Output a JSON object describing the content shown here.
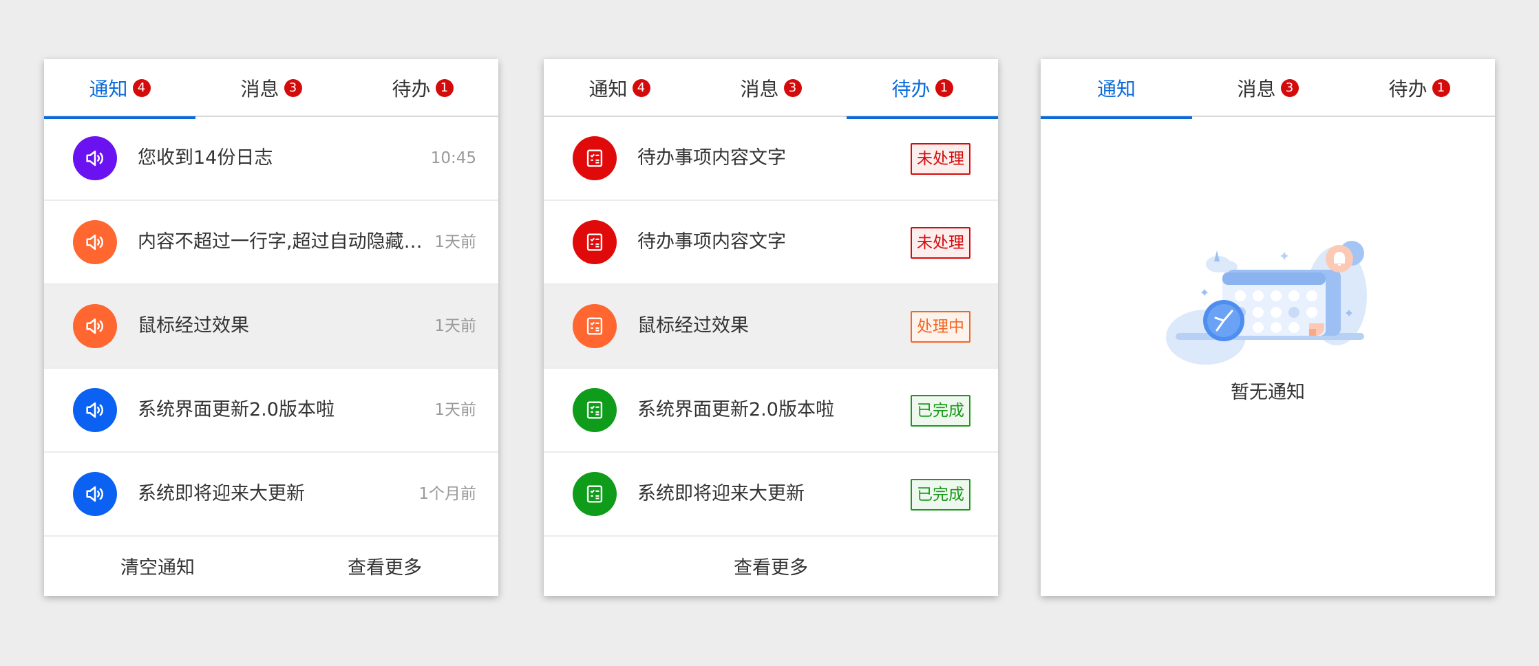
{
  "colors": {
    "accent": "#0b6bdb",
    "badge": "#d40b0b",
    "purple": "#6a12f0",
    "orange": "#ff6630",
    "blue": "#0b62f2",
    "red": "#e00a0a",
    "green": "#0f9c1a"
  },
  "panels": [
    {
      "tabs": [
        {
          "label": "通知",
          "badge": "4"
        },
        {
          "label": "消息",
          "badge": "3"
        },
        {
          "label": "待办",
          "badge": "1"
        }
      ],
      "items": [
        {
          "icon": "speaker-icon",
          "text": "您收到14份日志",
          "time": "10:45"
        },
        {
          "icon": "speaker-icon",
          "text": "内容不超过一行字,超过自动隐藏内容不超过一行字",
          "time": "1天前"
        },
        {
          "icon": "speaker-icon",
          "text": "鼠标经过效果",
          "time": "1天前"
        },
        {
          "icon": "speaker-icon",
          "text": "系统界面更新2.0版本啦",
          "time": "1天前"
        },
        {
          "icon": "speaker-icon",
          "text": "系统即将迎来大更新",
          "time": "1个月前"
        }
      ],
      "footer": [
        "清空通知",
        "查看更多"
      ]
    },
    {
      "tabs": [
        {
          "label": "通知",
          "badge": "4"
        },
        {
          "label": "消息",
          "badge": "3"
        },
        {
          "label": "待办",
          "badge": "1"
        }
      ],
      "items": [
        {
          "icon": "checklist-icon",
          "text": "待办事项内容文字",
          "status": "未处理"
        },
        {
          "icon": "checklist-icon",
          "text": "待办事项内容文字",
          "status": "未处理"
        },
        {
          "icon": "checklist-icon",
          "text": "鼠标经过效果",
          "status": "处理中"
        },
        {
          "icon": "checklist-icon",
          "text": "系统界面更新2.0版本啦",
          "status": "已完成"
        },
        {
          "icon": "checklist-icon",
          "text": "系统即将迎来大更新",
          "status": "已完成"
        }
      ],
      "footer": [
        "查看更多"
      ]
    },
    {
      "tabs": [
        {
          "label": "通知"
        },
        {
          "label": "消息",
          "badge": "3"
        },
        {
          "label": "待办",
          "badge": "1"
        }
      ],
      "empty": {
        "icon": "empty-calendar-illustration",
        "text": "暂无通知"
      }
    }
  ]
}
